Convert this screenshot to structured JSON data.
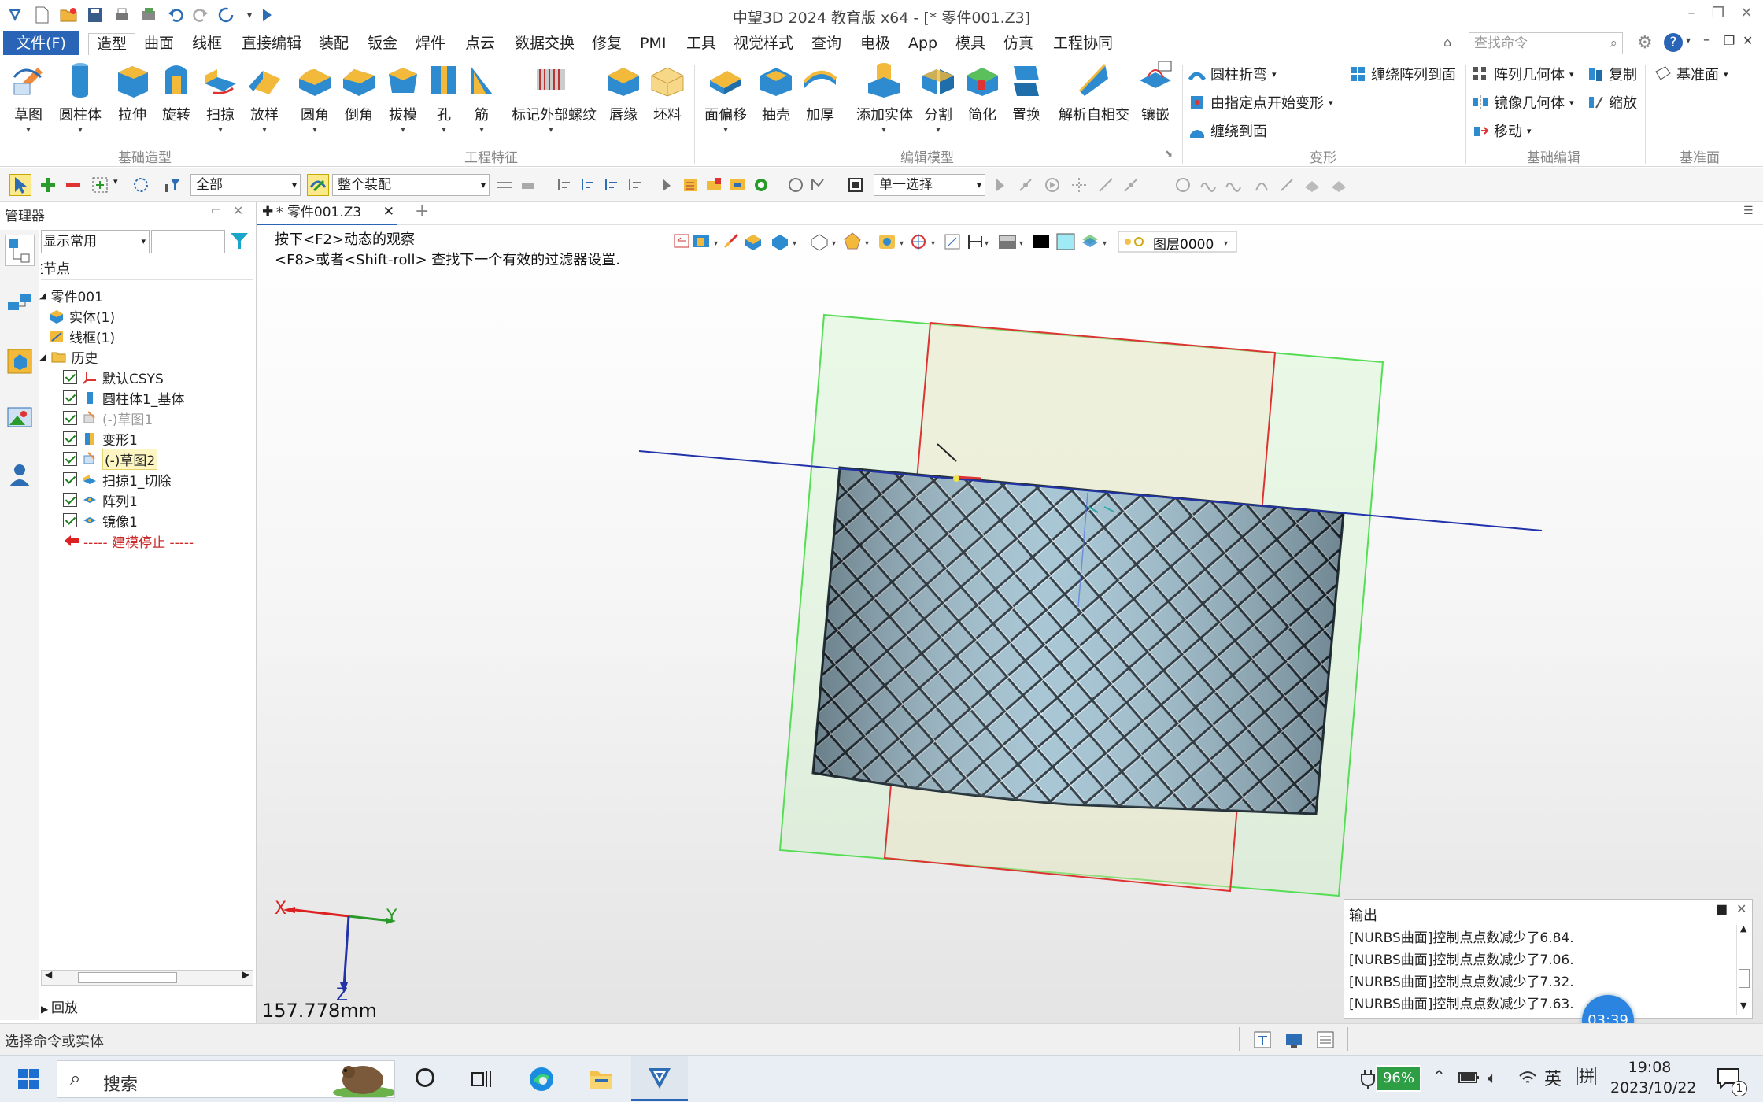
{
  "window": {
    "title": "中望3D 2024 教育版 x64 - [* 零件001.Z3]"
  },
  "menu": {
    "file": "文件(F)",
    "tabs": [
      "造型",
      "曲面",
      "线框",
      "直接编辑",
      "装配",
      "钣金",
      "焊件",
      "点云",
      "数据交换",
      "修复",
      "PMI",
      "工具",
      "视觉样式",
      "查询",
      "电极",
      "App",
      "模具",
      "仿真",
      "工程协同"
    ],
    "search_placeholder": "查找命令"
  },
  "ribbon": {
    "basic": [
      "草图",
      "圆柱体",
      "拉伸",
      "旋转",
      "扫掠",
      "放样"
    ],
    "basic_label": "基础造型",
    "eng": [
      "圆角",
      "倒角",
      "拔模",
      "孔",
      "筋",
      "标记外部螺纹",
      "唇缘",
      "坯料"
    ],
    "eng_label": "工程特征",
    "edit": [
      "面偏移",
      "抽壳",
      "加厚",
      "添加实体",
      "分割",
      "简化",
      "置换",
      "解析自相交",
      "镶嵌"
    ],
    "edit_label": "编辑模型",
    "deform": [
      "圆柱折弯",
      "由指定点开始变形",
      "缠绕到面",
      "缠绕阵列到面"
    ],
    "deform_label": "变形",
    "basic_edit": [
      "阵列几何体",
      "镜像几何体",
      "移动",
      "复制",
      "缩放"
    ],
    "basic_edit_label": "基础编辑",
    "datum": [
      "基准面"
    ],
    "datum_label": "基准面"
  },
  "toolbar": {
    "filter_all": "全部",
    "assembly": "整个装配",
    "select_mode": "单一选择"
  },
  "manager": {
    "title": "管理器",
    "display_mode": "显示常用",
    "node_header": "主节点",
    "root": "零件001",
    "solid": "实体(1)",
    "wire": "线框(1)",
    "history": "历史",
    "items": [
      "默认CSYS",
      "圆柱体1_基体",
      "(-)草图1",
      "变形1",
      "(-)草图2",
      "扫掠1_切除",
      "阵列1",
      "镜像1"
    ],
    "stop": "----- 建模停止 -----",
    "playback": "回放"
  },
  "document": {
    "tab": "* 零件001.Z3",
    "hint1": "按下<F2>动态的观察",
    "hint2": "<F8>或者<Shift-roll> 查找下一个有效的过滤器设置.",
    "layer": "图层0000",
    "scale": "157.778mm",
    "axis_x": "X",
    "axis_y": "Y",
    "axis_z": "Z"
  },
  "output": {
    "title": "输出",
    "lines": [
      "[NURBS曲面]控制点点数减少了6.84.",
      "[NURBS曲面]控制点点数减少了7.06.",
      "[NURBS曲面]控制点点数减少了7.32.",
      "[NURBS曲面]控制点点数减少了7.63."
    ],
    "timer": "03:39"
  },
  "status": {
    "prompt": "选择命令或实体"
  },
  "taskbar": {
    "search": "搜索",
    "battery": "96%",
    "ime1": "英",
    "ime2": "拼",
    "time": "19:08",
    "date": "2023/10/22",
    "notif": "1"
  },
  "colors": {
    "accent": "#2a64b7",
    "mesh": "#a8c7d6",
    "green_frame": "#55dd55",
    "red_frame": "#dd3333",
    "blue_axis": "#2233aa"
  }
}
